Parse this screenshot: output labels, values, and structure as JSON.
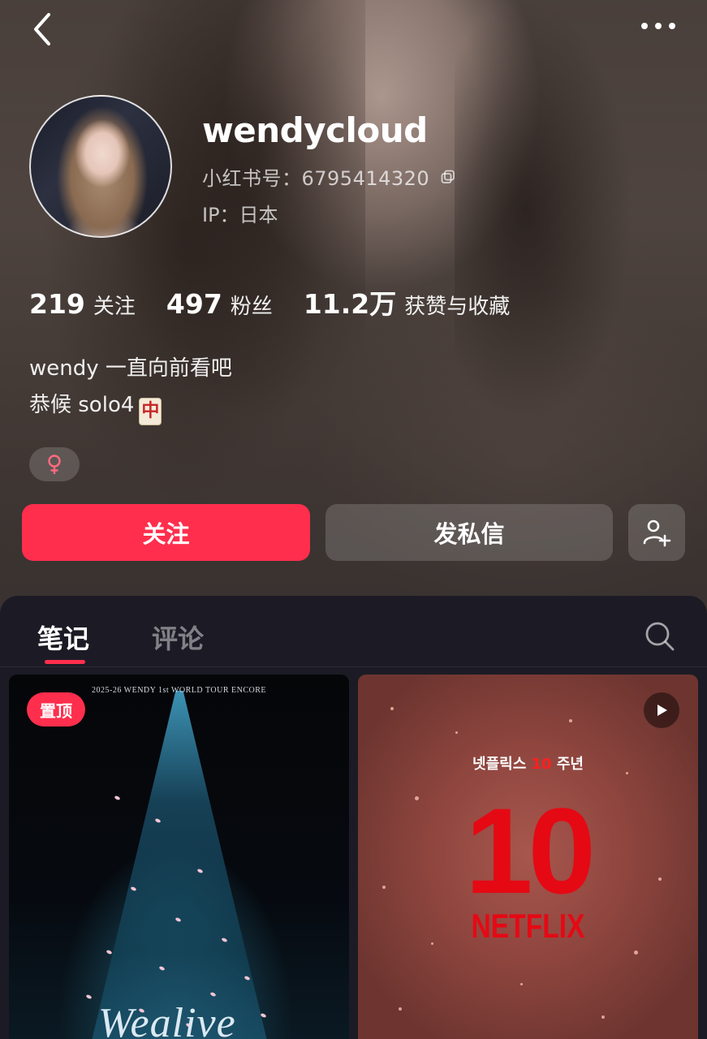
{
  "header": {
    "back_icon": "chevron-left-icon",
    "more_icon": "more-dots-icon"
  },
  "profile": {
    "username": "wendycloud",
    "red_id": "小红书号：6795414320",
    "ip": "IP：日本",
    "gender_symbol": "♀"
  },
  "stats": [
    {
      "value": "219",
      "label": "关注"
    },
    {
      "value": "497",
      "label": "粉丝"
    },
    {
      "value": "11.2万",
      "label": "获赞与收藏"
    }
  ],
  "bio": {
    "line1": "wendy 一直向前看吧",
    "line2": "恭候 solo4",
    "emoji": "中"
  },
  "actions": {
    "follow_label": "关注",
    "message_label": "发私信"
  },
  "tabs": {
    "notes": "笔记",
    "comments": "评论",
    "active": "notes"
  },
  "cards": [
    {
      "pin_label": "置顶",
      "top_text": "2025-26 WENDY 1st WORLD TOUR ENCORE",
      "script_text": "Wealive"
    },
    {
      "korean_prefix": "넷플릭스 ",
      "korean_number": "10",
      "korean_suffix": " 주년",
      "big_number": "10",
      "brand": "NETFLIX",
      "is_video": true
    }
  ],
  "colors": {
    "accent": "#ff2e4d",
    "panel_bg": "#1c1b25",
    "netflix_red": "#e50914"
  }
}
